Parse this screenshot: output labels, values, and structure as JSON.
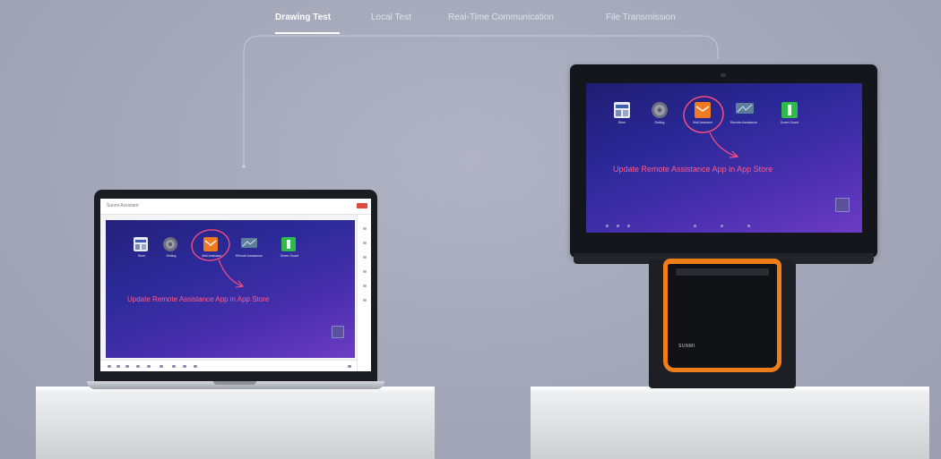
{
  "tabs": [
    {
      "label": "Drawing Test",
      "active": true
    },
    {
      "label": "Local Test",
      "active": false
    },
    {
      "label": "Real-Time Communication",
      "active": false
    },
    {
      "label": "File Transmission",
      "active": false
    }
  ],
  "laptop": {
    "window_title": "Sunmi Assistant",
    "desktop_icons": [
      {
        "label": "Store",
        "icon": "store-icon"
      },
      {
        "label": "Setting",
        "icon": "settings-icon"
      },
      {
        "label": "Mail Assistant",
        "icon": "mail-icon"
      },
      {
        "label": "Remote Assistance",
        "icon": "remote-assistance-icon"
      },
      {
        "label": "Green Guard",
        "icon": "green-app-icon"
      }
    ],
    "annotation": "Update Remote Assistance App in App Store"
  },
  "pos": {
    "brand": "SUNMI",
    "desktop_icons": [
      {
        "label": "Store",
        "icon": "store-icon"
      },
      {
        "label": "Setting",
        "icon": "settings-icon"
      },
      {
        "label": "Mail Assistant",
        "icon": "mail-icon"
      },
      {
        "label": "Remote Assistance",
        "icon": "remote-assistance-icon"
      },
      {
        "label": "Green Guard",
        "icon": "green-app-icon"
      }
    ],
    "annotation": "Update Remote Assistance App in App Store"
  },
  "colors": {
    "background": "#a4a8ba",
    "accent_orange": "#ef7d1a",
    "annotation_pink": "#ff5d87",
    "screen_blue": "#2a2897",
    "screen_purple": "#6c3cc4"
  }
}
